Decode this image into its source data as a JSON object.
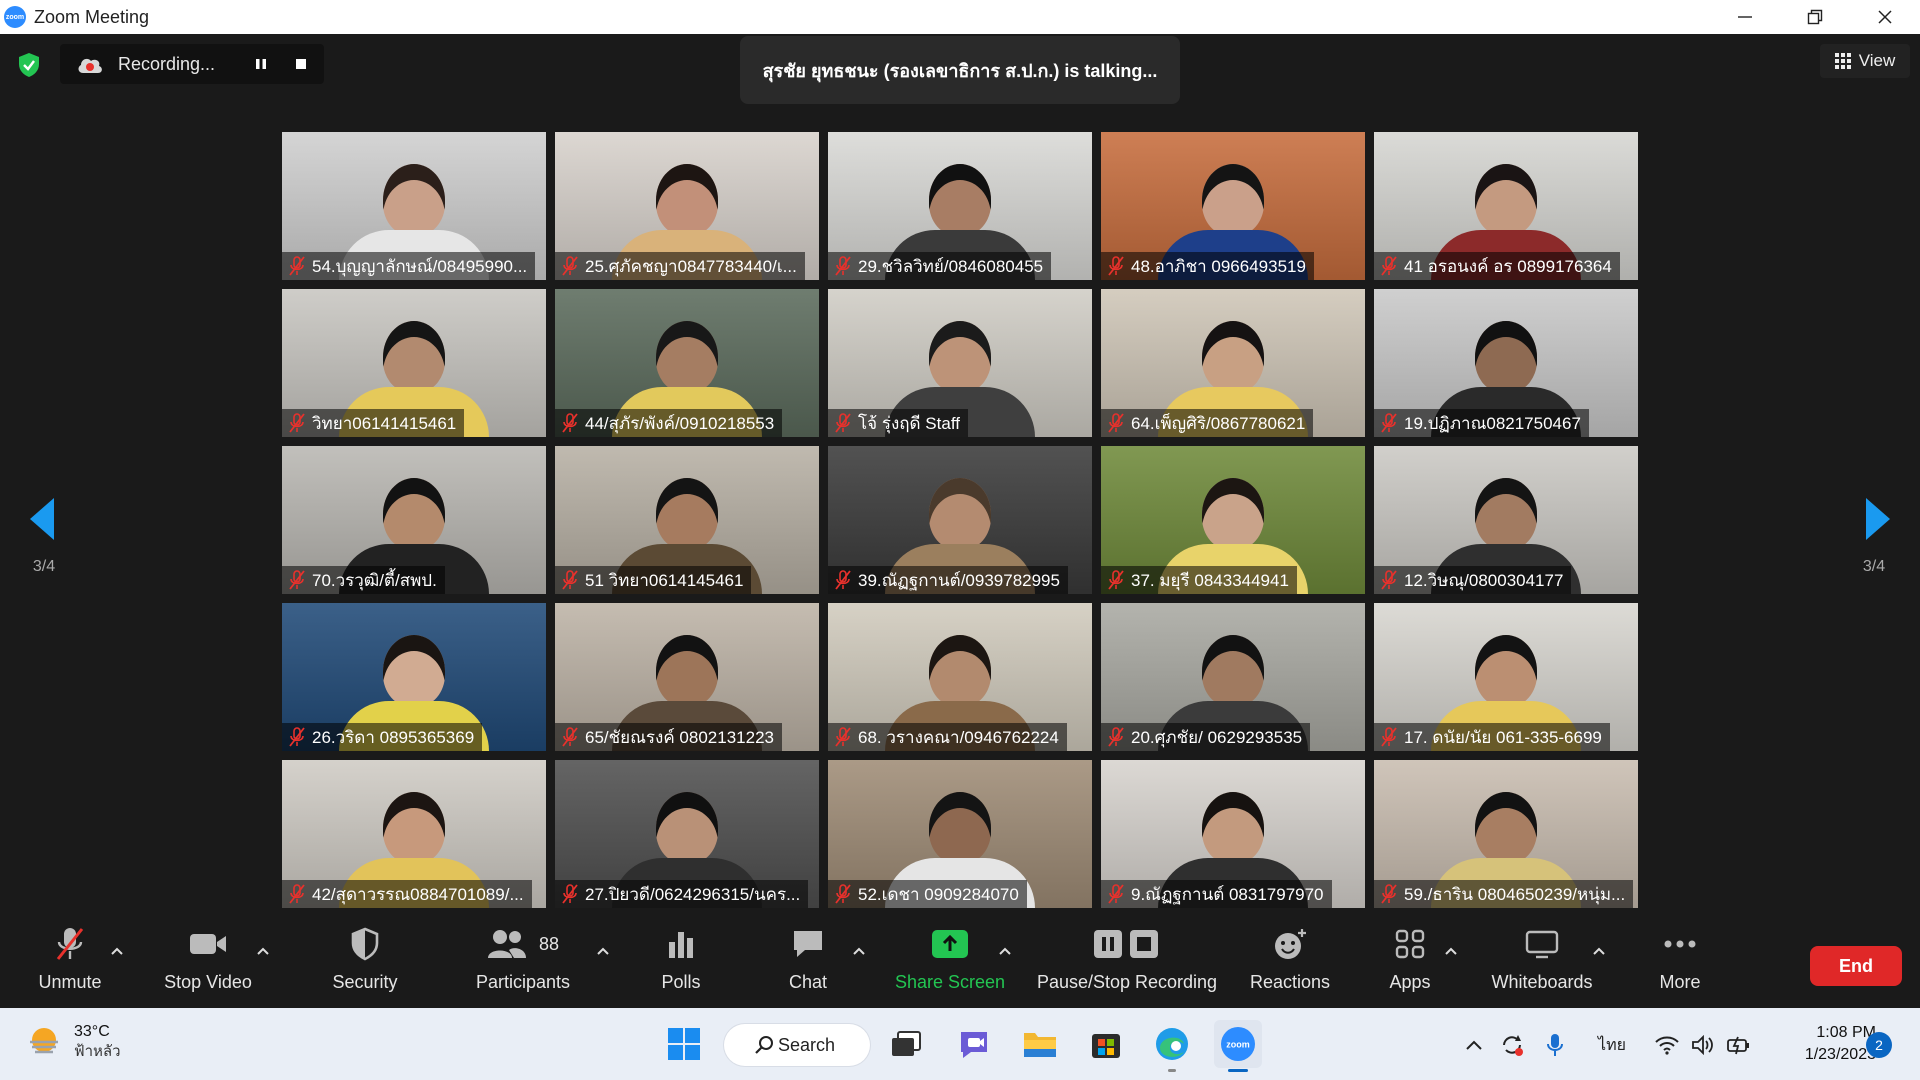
{
  "window": {
    "title": "Zoom Meeting",
    "logo_text": "zoom"
  },
  "recording": {
    "label": "Recording..."
  },
  "talking_banner": "สุรชัย ยุทธชนะ (รองเลขาธิการ ส.ป.ก.) is talking...",
  "view_button": "View",
  "paging": {
    "left": "3/4",
    "right": "3/4"
  },
  "participants_grid": [
    {
      "name": "54.บุญญาลักษณ์/08495990...",
      "bg": "#cfcfcf",
      "skin": "#c9a089",
      "shirt": "#e6e6e6",
      "hair": "#2b1f1a"
    },
    {
      "name": "25.ศุภัคชญา0847783440/เ...",
      "bg": "#d8d2cc",
      "skin": "#c29079",
      "shirt": "#d9b27a",
      "hair": "#1d1512"
    },
    {
      "name": "29.ชวิลวิทย์/0846080455",
      "bg": "#d9d9d6",
      "skin": "#a87d64",
      "shirt": "#3a3a3a",
      "hair": "#111"
    },
    {
      "name": "48.อาภิชา 0966493519",
      "bg": "#c76d3d",
      "skin": "#caa08a",
      "shirt": "#1e3f8a",
      "hair": "#141414"
    },
    {
      "name": "41 อรอนงค์ อร 0899176364",
      "bg": "#d6d6d2",
      "skin": "#c49a80",
      "shirt": "#8c2a2a",
      "hair": "#1a1414"
    },
    {
      "name": "วิทยา06141415461",
      "bg": "#c8c6c1",
      "skin": "#b28a6f",
      "shirt": "#e5c95a",
      "hair": "#151515"
    },
    {
      "name": "44/สุภัร/พังค์/0910218553",
      "bg": "#5b6b5c",
      "skin": "#a57d62",
      "shirt": "#e2c95c",
      "hair": "#181818"
    },
    {
      "name": "โจ้ รุ่งฤดี Staff",
      "bg": "#d0cdc5",
      "skin": "#bd9378",
      "shirt": "#3f3f3f",
      "hair": "#1b1b1b"
    },
    {
      "name": "64.เพ็ญศิริ/0867780621",
      "bg": "#cfc6b7",
      "skin": "#c8a083",
      "shirt": "#e7c95f",
      "hair": "#151212"
    },
    {
      "name": "19.ปฏิภาณ0821750467",
      "bg": "#c9c9c9",
      "skin": "#8e6a52",
      "shirt": "#2a2a2a",
      "hair": "#111"
    },
    {
      "name": "70.วรวุฒิ/ตี้/สพป.",
      "bg": "#b9b7b2",
      "skin": "#b48a6c",
      "shirt": "#222",
      "hair": "#121212"
    },
    {
      "name": "51 วิทยา0614145461",
      "bg": "#b7b0a4",
      "skin": "#a67b5f",
      "shirt": "#5b4a34",
      "hair": "#141414"
    },
    {
      "name": "39.ณัฏฐกานต์/0939782995",
      "bg": "#3a3a3a",
      "skin": "#b48b70",
      "shirt": "#9b7f5e",
      "hair": "#4a3a2c"
    },
    {
      "name": "37. มยุรี 0843344941",
      "bg": "#6f8a3a",
      "skin": "#c9a38a",
      "shirt": "#e8d36a",
      "hair": "#1c1612"
    },
    {
      "name": "12.วิษณุ/0800304177",
      "bg": "#cbc9c4",
      "skin": "#a27b61",
      "shirt": "#2f2f2f",
      "hair": "#141414"
    },
    {
      "name": "26.วริดา 0895365369",
      "bg": "#204a78",
      "skin": "#d1ab92",
      "shirt": "#e2d14a",
      "hair": "#1a1512"
    },
    {
      "name": "65/ชัยณรงค์ 0802131223",
      "bg": "#bdb3a6",
      "skin": "#9d7559",
      "shirt": "#5a4a3a",
      "hair": "#121212"
    },
    {
      "name": "68. วรางคณา/0946762224",
      "bg": "#d1cbbd",
      "skin": "#b28a6e",
      "shirt": "#8a6a4a",
      "hair": "#1c1612"
    },
    {
      "name": "20.ศุภชัย/ 0629293535",
      "bg": "#a9a9a2",
      "skin": "#a07a60",
      "shirt": "#3b3b3b",
      "hair": "#121212"
    },
    {
      "name": "17. ดนัย/นัย 061-335-6699",
      "bg": "#d8d6d0",
      "skin": "#bb8f72",
      "shirt": "#e6c85a",
      "hair": "#131313"
    },
    {
      "name": "42/สุดาวรรณ0884701089/...",
      "bg": "#cfcbc4",
      "skin": "#c7997c",
      "shirt": "#e2c35a",
      "hair": "#1c1512"
    },
    {
      "name": "27.ปิยวดี/0624296315/นคร...",
      "bg": "#4f4f4f",
      "skin": "#b99177",
      "shirt": "#2f2f2f",
      "hair": "#101010"
    },
    {
      "name": "52.เดชา 0909284070",
      "bg": "#9f8c76",
      "skin": "#8e6850",
      "shirt": "#e5e5e5",
      "hair": "#141414"
    },
    {
      "name": "9.ณัฏฐกานต์ 0831797970",
      "bg": "#d7d3ce",
      "skin": "#c39a7e",
      "shirt": "#2f2f2f",
      "hair": "#161210"
    },
    {
      "name": "59./ธาริน 0804650239/หนุ่ม...",
      "bg": "#c9bdb0",
      "skin": "#a87e62",
      "shirt": "#d6c27a",
      "hair": "#121212"
    }
  ],
  "toolbar": {
    "unmute": "Unmute",
    "stop_video": "Stop Video",
    "security": "Security",
    "participants": "Participants",
    "participants_count": "88",
    "polls": "Polls",
    "chat": "Chat",
    "share_screen": "Share Screen",
    "pause_stop_recording": "Pause/Stop Recording",
    "reactions": "Reactions",
    "apps": "Apps",
    "whiteboards": "Whiteboards",
    "more": "More",
    "end": "End"
  },
  "taskbar": {
    "weather_temp": "33°C",
    "weather_condition": "ฟ้าหลัว",
    "search": "Search",
    "language": "ไทย",
    "time": "1:08 PM",
    "date": "1/23/2023",
    "notification_count": "2"
  },
  "colors": {
    "accent_green": "#23c552",
    "end_red": "#e02828",
    "arrow_blue": "#1a9af0",
    "mic_muted_red": "#e8312c"
  }
}
